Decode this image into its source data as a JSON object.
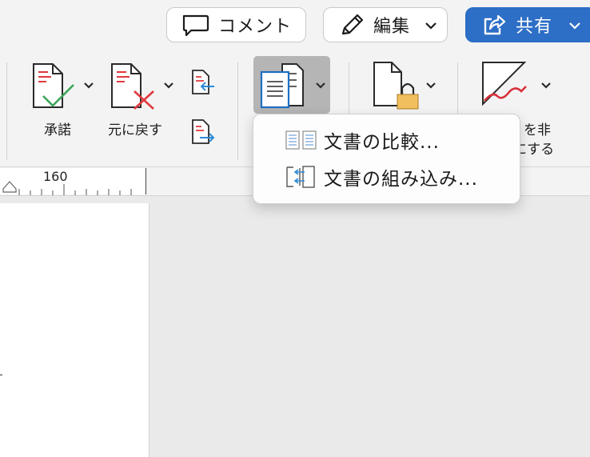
{
  "header": {
    "comment_label": "コメント",
    "edit_label": "編集",
    "share_label": "共有"
  },
  "ribbon": {
    "accept_label": "承諾",
    "reject_label": "元に戻す",
    "hide_label_line1": "を非",
    "hide_label_line2": "にする"
  },
  "ruler": {
    "mark": "160"
  },
  "compare_menu": {
    "items": [
      {
        "label": "文書の比較...",
        "icon": "compare-documents-icon"
      },
      {
        "label": "文書の組み込み...",
        "icon": "combine-documents-icon"
      }
    ]
  },
  "colors": {
    "accent": "#2d6ec6",
    "accept_check": "#3fa45b",
    "reject_x": "#e0393e",
    "lock": "#f2bf5e",
    "track_arrow": "#2d8ad6"
  }
}
